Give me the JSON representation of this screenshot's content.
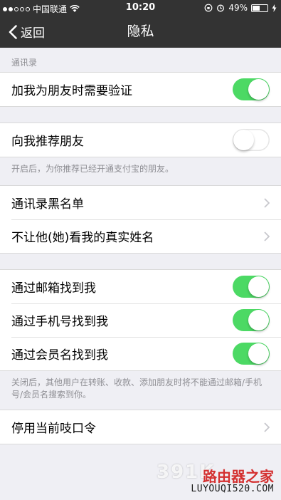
{
  "status_bar": {
    "signal_dots_filled": 2,
    "signal_dots_total": 5,
    "carrier": "中国联通",
    "time": "10:20",
    "battery_text": "49%",
    "battery_level": 0.49
  },
  "nav": {
    "back_label": "返回",
    "title": "隐私"
  },
  "sections": {
    "contacts_header": "通讯录",
    "verify_label": "加我为朋友时需要验证",
    "verify_on": true,
    "recommend_label": "向我推荐朋友",
    "recommend_on": false,
    "recommend_footer": "开启后，为你推荐已经开通支付宝的朋友。",
    "blacklist_label": "通讯录黑名单",
    "hide_realname_label": "不让他(她)看我的真实姓名",
    "find_email_label": "通过邮箱找到我",
    "find_email_on": true,
    "find_phone_label": "通过手机号找到我",
    "find_phone_on": true,
    "find_member_label": "通过会员名找到我",
    "find_member_on": true,
    "find_footer": "关闭后，其他用户在转账、收款、添加朋友时将不能通过邮箱/手机号/会员名搜索到你。",
    "disable_password_label": "停用当前吱口令"
  },
  "watermark": {
    "number": "391K",
    "brand": "路由器之家",
    "url": "LUYOUQI520.COM"
  },
  "colors": {
    "toggle_on": "#4cd964",
    "nav_background": "#333333",
    "page_background": "#efeff4"
  }
}
